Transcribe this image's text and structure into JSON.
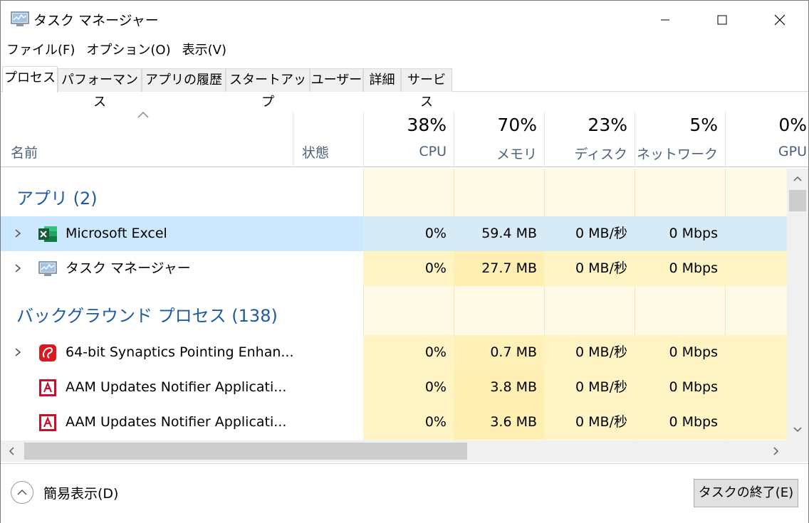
{
  "window": {
    "title": "タスク マネージャー"
  },
  "menu": [
    "ファイル(F)",
    "オプション(O)",
    "表示(V)"
  ],
  "tabs": [
    {
      "label": "プロセス",
      "active": true
    },
    {
      "label": "パフォーマンス"
    },
    {
      "label": "アプリの履歴"
    },
    {
      "label": "スタートアップ"
    },
    {
      "label": "ユーザー"
    },
    {
      "label": "詳細"
    },
    {
      "label": "サービス"
    }
  ],
  "columns": {
    "name": "名前",
    "status": "状態",
    "cpu": {
      "pct": "38%",
      "label": "CPU"
    },
    "memory": {
      "pct": "70%",
      "label": "メモリ"
    },
    "disk": {
      "pct": "23%",
      "label": "ディスク"
    },
    "network": {
      "pct": "5%",
      "label": "ネットワーク"
    },
    "gpu": {
      "pct": "0%",
      "label": "GPU"
    }
  },
  "groups": {
    "apps": "アプリ (2)",
    "background": "バックグラウンド プロセス (138)"
  },
  "rows": [
    {
      "name": "Microsoft Excel",
      "icon": "excel-icon",
      "cpu": "0%",
      "memory": "59.4 MB",
      "disk": "0 MB/秒",
      "network": "0 Mbps",
      "selected": true
    },
    {
      "name": "タスク マネージャー",
      "icon": "task-manager-icon",
      "cpu": "0%",
      "memory": "27.7 MB",
      "disk": "0 MB/秒",
      "network": "0 Mbps"
    },
    {
      "name": "64-bit Synaptics Pointing Enhan...",
      "icon": "synaptics-icon",
      "cpu": "0%",
      "memory": "0.7 MB",
      "disk": "0 MB/秒",
      "network": "0 Mbps"
    },
    {
      "name": "AAM Updates Notifier Applicati...",
      "icon": "adobe-icon",
      "cpu": "0%",
      "memory": "3.8 MB",
      "disk": "0 MB/秒",
      "network": "0 Mbps"
    },
    {
      "name": "AAM Updates Notifier Applicati...",
      "icon": "adobe-icon",
      "cpu": "0%",
      "memory": "3.6 MB",
      "disk": "0 MB/秒",
      "network": "0 Mbps"
    }
  ],
  "footer": {
    "fewer_details": "簡易表示(D)",
    "end_task": "タスクの終了(E)"
  },
  "colors": {
    "heat_light": "#fff9e5",
    "heat_medium": "#fff4c4",
    "heat_strong": "#ffefb3",
    "selected": "#cce8ff",
    "group_title": "#1e5aa8"
  }
}
